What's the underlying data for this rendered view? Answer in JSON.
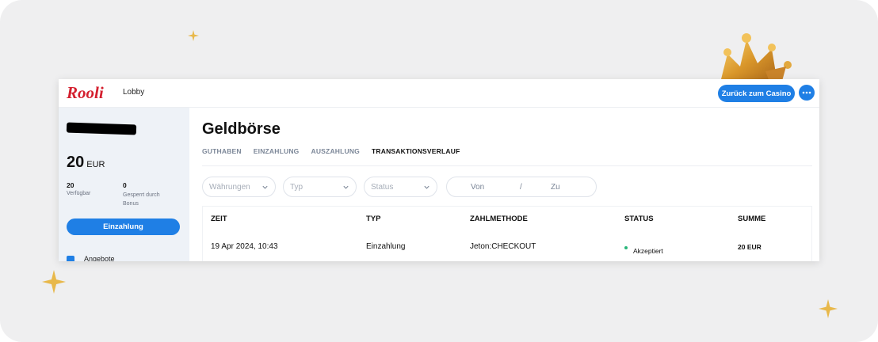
{
  "header": {
    "logo_text": "Rooli",
    "lobby_label": "Lobby",
    "back_button_label": "Zurück zum Casino",
    "more_icon": "ellipsis-icon"
  },
  "sidebar": {
    "balance_value": "20",
    "balance_currency": "EUR",
    "available_value": "20",
    "available_label": "Verfügbar",
    "locked_value": "0",
    "locked_label": "Gesperrt durch Bonus",
    "deposit_button_label": "Einzahlung",
    "offers_label": "Angebote"
  },
  "main": {
    "title": "Geldbörse",
    "tabs": [
      {
        "label": "GUTHABEN",
        "active": false
      },
      {
        "label": "EINZAHLUNG",
        "active": false
      },
      {
        "label": "AUSZAHLUNG",
        "active": false
      },
      {
        "label": "TRANSAKTIONSVERLAUF",
        "active": true
      }
    ],
    "filters": {
      "currency_placeholder": "Währungen",
      "type_placeholder": "Typ",
      "status_placeholder": "Status",
      "date_from": "Von",
      "date_separator": "/",
      "date_to": "Zu"
    },
    "table": {
      "headers": [
        "ZEIT",
        "TYP",
        "ZAHLMETHODE",
        "STATUS",
        "SUMME"
      ],
      "rows": [
        [
          "19 Apr 2024, 10:43",
          "Einzahlung",
          "Jeton:CHECKOUT",
          "Akzeptiert",
          "20 EUR"
        ]
      ]
    }
  },
  "colors": {
    "accent": "#1f7fe5",
    "status_ok": "#29b67a",
    "logo": "#d4202f"
  }
}
